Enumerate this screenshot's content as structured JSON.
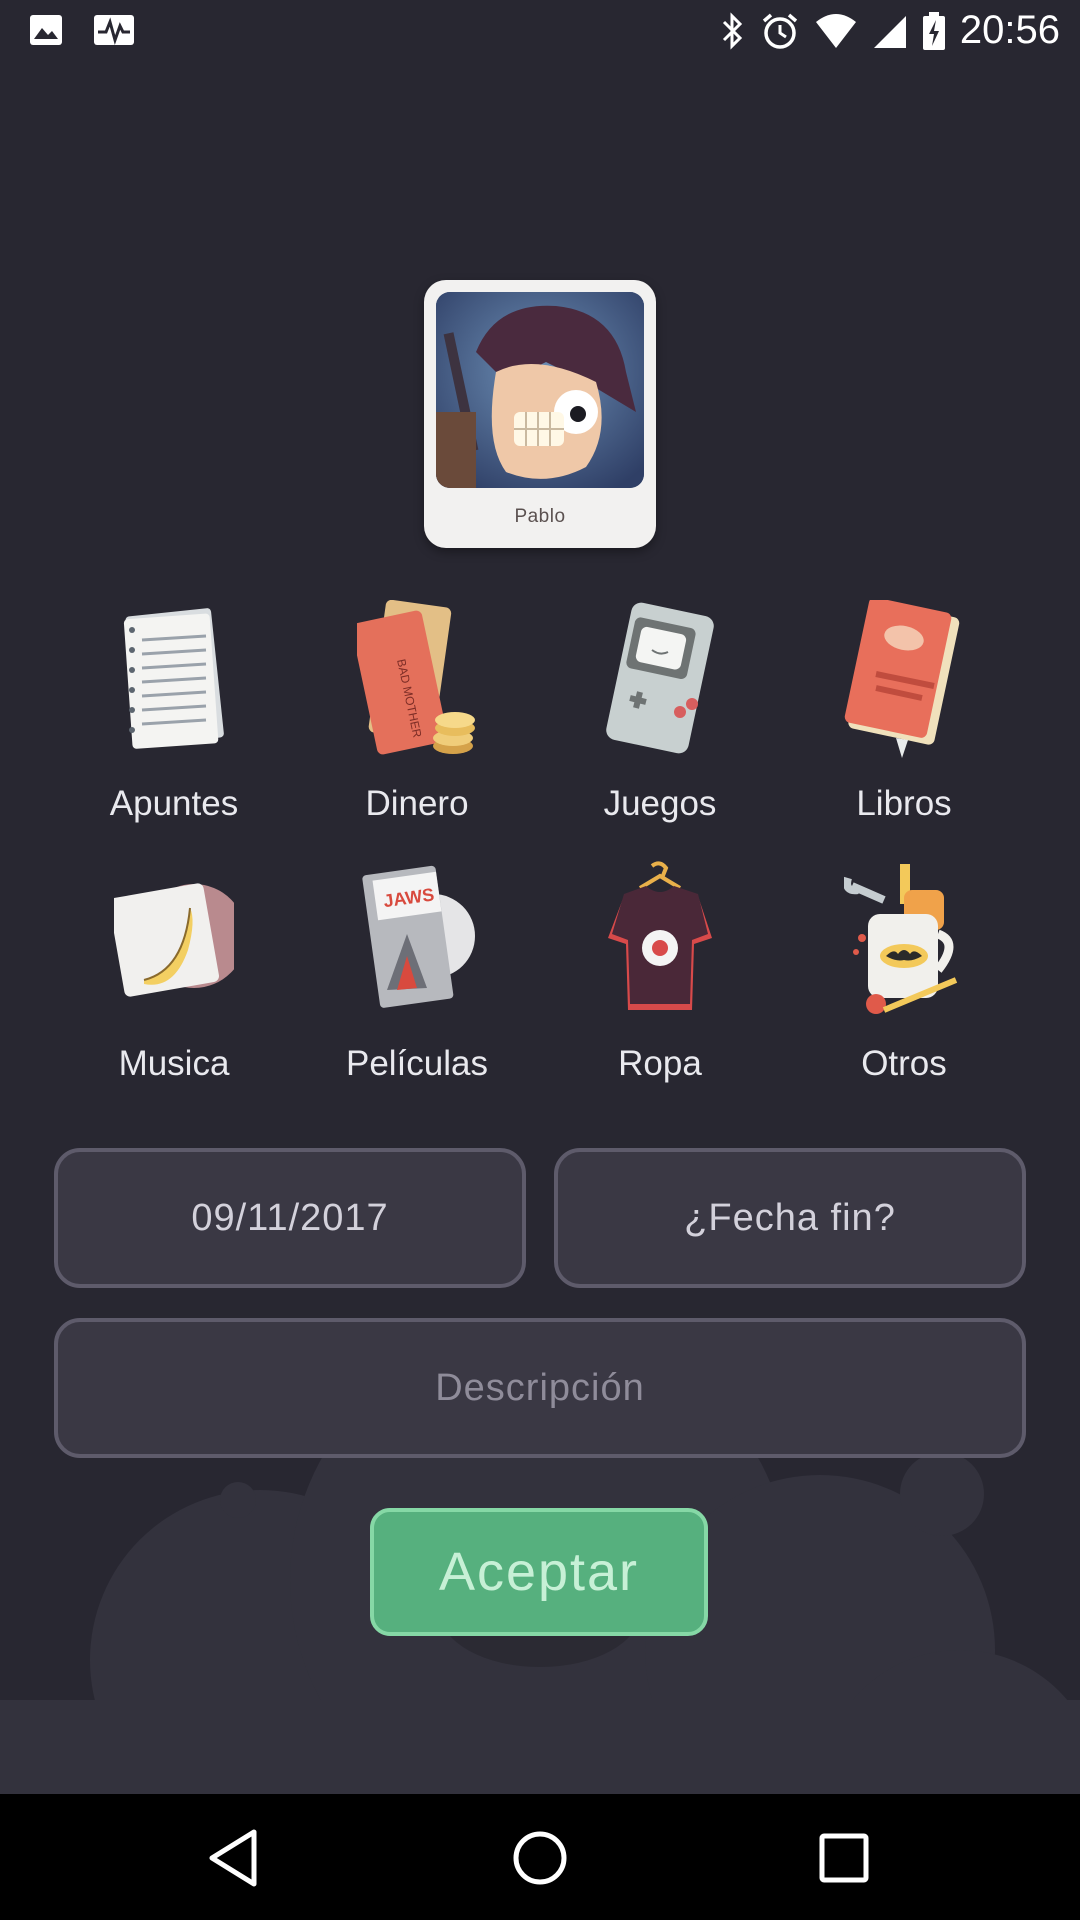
{
  "status_bar": {
    "time": "20:56",
    "left_icons": [
      "image-icon",
      "pulse-icon"
    ],
    "right_icons": [
      "bluetooth-icon",
      "alarm-icon",
      "wifi-icon",
      "signal-icon",
      "battery-charging-icon"
    ]
  },
  "profile": {
    "name": "Pablo"
  },
  "categories": [
    {
      "label": "Apuntes",
      "icon": "notebook-icon"
    },
    {
      "label": "Dinero",
      "icon": "money-icon"
    },
    {
      "label": "Juegos",
      "icon": "gameboy-icon"
    },
    {
      "label": "Libros",
      "icon": "book-icon"
    },
    {
      "label": "Musica",
      "icon": "vinyl-icon"
    },
    {
      "label": "Películas",
      "icon": "movie-dvd-icon"
    },
    {
      "label": "Ropa",
      "icon": "tshirt-icon"
    },
    {
      "label": "Otros",
      "icon": "mug-tools-icon"
    }
  ],
  "form": {
    "start_date": "09/11/2017",
    "end_date_placeholder": "¿Fecha fin?",
    "description_placeholder": "Descripción",
    "accept_label": "Aceptar"
  },
  "colors": {
    "background": "#282731",
    "field_bg": "#3a3844",
    "field_border": "#5e5b6b",
    "accept": "#56b07e"
  },
  "nav_bar": {
    "icons": [
      "back-icon",
      "home-icon",
      "recents-icon"
    ]
  }
}
